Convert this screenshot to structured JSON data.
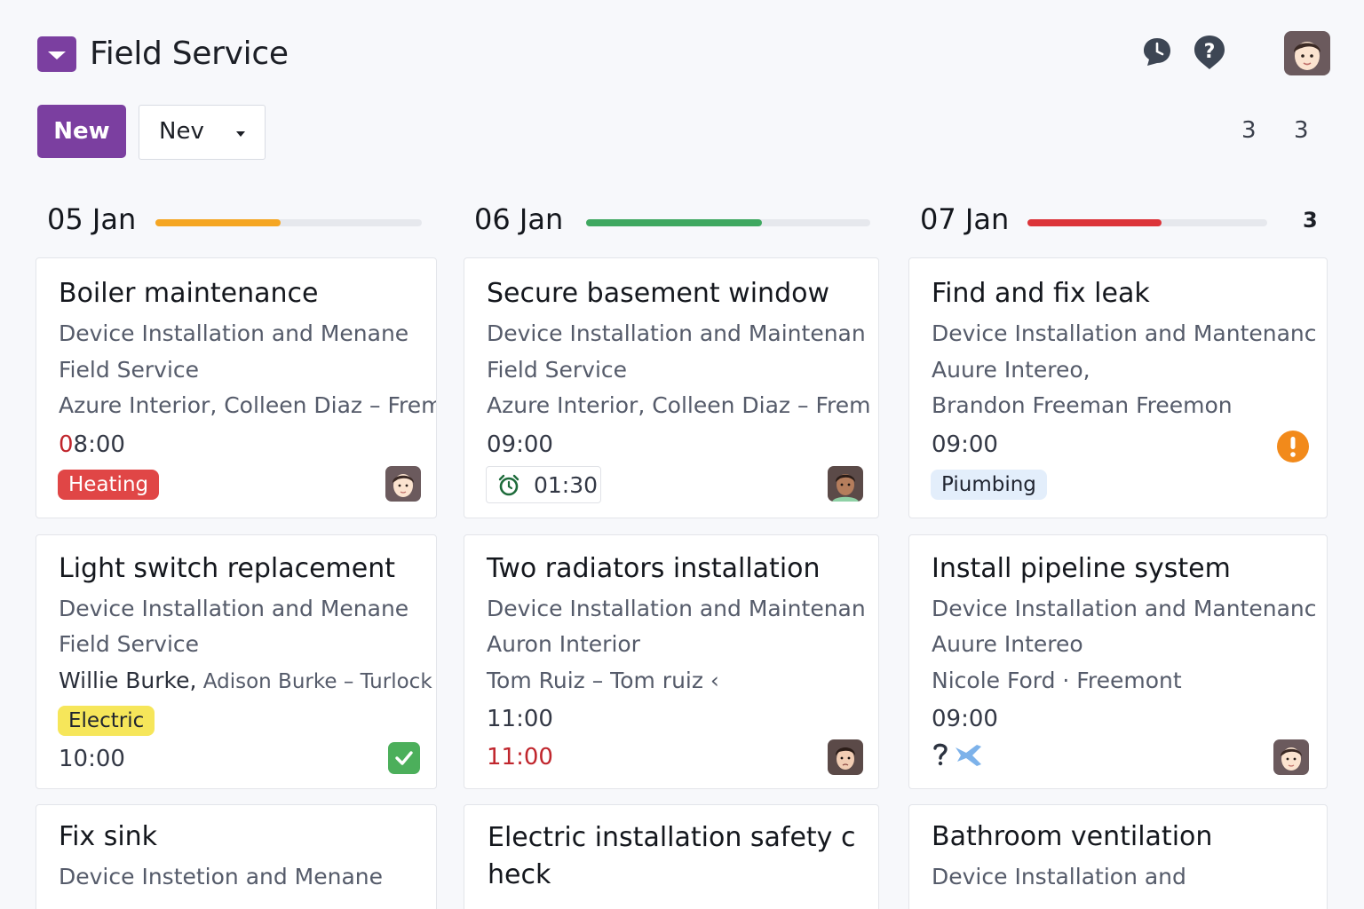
{
  "header": {
    "title": "Field Service",
    "icons": [
      "app-logo-icon",
      "clock-chat-icon",
      "help-icon",
      "avatar"
    ]
  },
  "toolbar": {
    "new_label": "New",
    "view_select": "Nev",
    "pager_a": "3",
    "pager_b": "3"
  },
  "columns": [
    {
      "date": "05 Jan",
      "progress": 0.47,
      "progress_color": "#f5a623"
    },
    {
      "date": "06 Jan",
      "progress": 0.62,
      "progress_color": "#3fa860"
    },
    {
      "date": "07 Jan",
      "progress": 0.56,
      "progress_color": "#dc3439",
      "count": "3"
    }
  ],
  "cards": {
    "c1": {
      "title": "Boiler maintenance",
      "line1": "Device Installation and Menane",
      "line2": "Field Service",
      "line3": "Azure Interior, Colleen Diaz – Frem",
      "time_prefix": "0",
      "time_rest": "8:00",
      "tag": "Heating",
      "tag_color": "#e04646"
    },
    "c2": {
      "title": "Secure basement window",
      "line1": "Device Installation and Maintenan",
      "line2": "Field Service",
      "line3": "Azure Interior, Colleen Diaz – Frem",
      "time": "09:00",
      "timer": "01:30"
    },
    "c3": {
      "title": "Find and fix leak",
      "line1": "Device Installation and Mantenanc",
      "line2": "Auure Intereo,",
      "line3": "Brandon Freeman  Freemon",
      "time": "09:00",
      "tag": "Piumbing",
      "warn_color": "#f28a1b"
    },
    "c4": {
      "title": "Light switch replacement",
      "line1": "Device Installation and Menane",
      "line2": "Field Service",
      "line3a": "Willie Burke,",
      "line3b": " Adison Burke – Turlock",
      "tag": "Electric",
      "tag_color": "#f6e65a",
      "time": "10:00",
      "done_color": "#4caf5b"
    },
    "c5": {
      "title": "Two radiators installation",
      "line1": "Device Installation and Maintenan",
      "line2": "Auron Interior",
      "line3": "Tom Ruiz  – Tom ruiz ‹",
      "time": "11:00",
      "deadline": "11:00"
    },
    "c6": {
      "title": "Install pipeline system",
      "line1": "Device Installation and Mantenanc",
      "line2": "Auure Intereo",
      "line3": "Nicole Ford · Freemont",
      "time": "09:00"
    },
    "c7": {
      "title": "Fix sink",
      "line1": "Device Instetion and Menane"
    },
    "c8": {
      "title": "Electric installation safety c heck"
    },
    "c9": {
      "title": "Bathroom ventilation",
      "line1": "Device Installation and"
    }
  }
}
